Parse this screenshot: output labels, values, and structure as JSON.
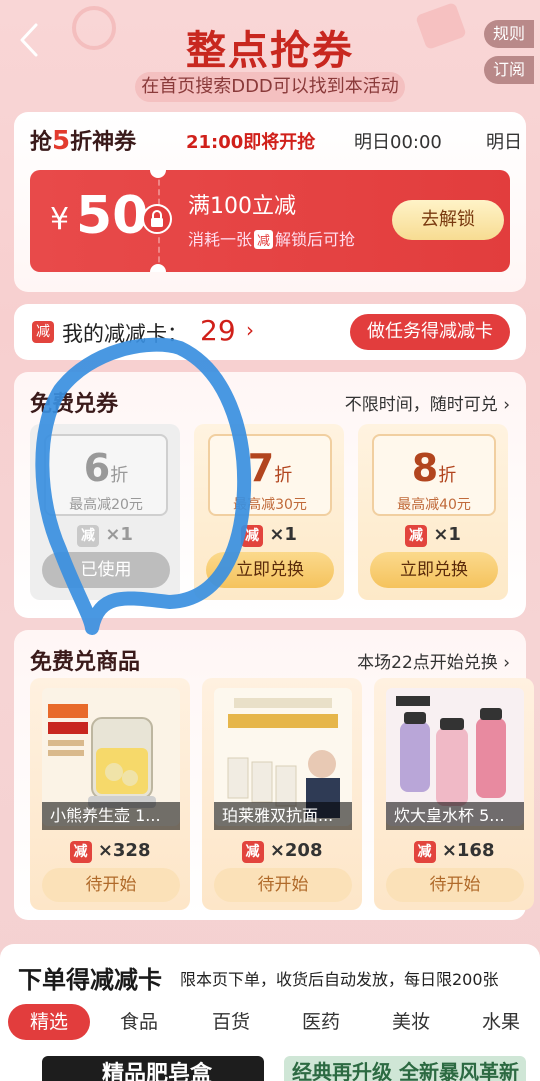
{
  "header": {
    "title": "整点抢券",
    "subtitle": "在首页搜索DDD可以找到本活动",
    "rules_btn": "规则",
    "subscribe_btn": "订阅"
  },
  "flash_sale": {
    "title_prefix": "抢",
    "title_num": "5",
    "title_suffix": "折神券",
    "time_slots": [
      "21:00即将开抢",
      "明日00:00",
      "明日"
    ],
    "coupon": {
      "currency": "¥",
      "amount": "50",
      "condition": "满100立减",
      "desc_before": "消耗一张",
      "desc_tag": "减",
      "desc_after": "解锁后可抢",
      "button": "去解锁"
    }
  },
  "my_cards": {
    "badge": "减",
    "label": "我的减减卡：",
    "count": "29",
    "arrow": "›",
    "task_button": "做任务得减减卡"
  },
  "free_coupons": {
    "title": "免费兑券",
    "link": "不限时间，随时可兑",
    "items": [
      {
        "discount": "6",
        "unit": "折",
        "max": "最高减20元",
        "badge": "减",
        "cost": "×1",
        "button": "已使用",
        "state": "used"
      },
      {
        "discount": "7",
        "unit": "折",
        "max": "最高减30元",
        "badge": "减",
        "cost": "×1",
        "button": "立即兑换",
        "state": "available"
      },
      {
        "discount": "8",
        "unit": "折",
        "max": "最高减40元",
        "badge": "减",
        "cost": "×1",
        "button": "立即兑换",
        "state": "available"
      }
    ]
  },
  "free_products": {
    "title": "免费兑商品",
    "link": "本场22点开始兑换",
    "items": [
      {
        "name": "小熊养生壶 1...",
        "badge": "减",
        "cost": "×328",
        "button": "待开始"
      },
      {
        "name": "珀莱雅双抗面...",
        "badge": "减",
        "cost": "×208",
        "button": "待开始"
      },
      {
        "name": "炊大皇水杯 5...",
        "badge": "减",
        "cost": "×168",
        "button": "待开始"
      }
    ]
  },
  "order_section": {
    "title": "下单得减减卡",
    "subtitle": "限本页下单，收货后自动发放，每日限200张",
    "tabs": [
      "精选",
      "食品",
      "百货",
      "医药",
      "美妆",
      "水果"
    ],
    "banner_left": "精品肥皂盒",
    "banner_right": "经典再升级 全新暴风革新"
  },
  "colors": {
    "brand_red": "#e23d3d",
    "title_red": "#c8271f",
    "gold_button": "#f5c35d",
    "scribble_blue": "#3a8fe0"
  }
}
